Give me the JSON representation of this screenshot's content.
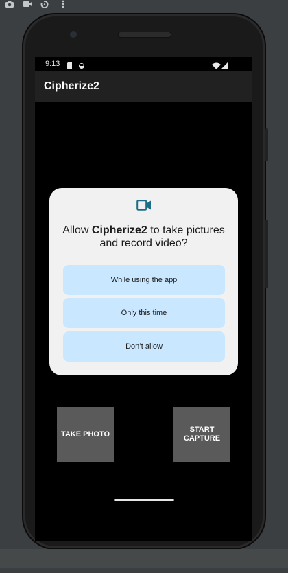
{
  "status_bar": {
    "time": "9:13"
  },
  "app_bar": {
    "title": "Cipherize2"
  },
  "dialog": {
    "message_prefix": "Allow ",
    "app_name": "Cipherize2",
    "message_suffix": " to take pictures and record video?",
    "options": [
      "While using the app",
      "Only this time",
      "Don’t allow"
    ],
    "accent_color": "#1a6e86",
    "option_bg": "#c9e7ff"
  },
  "buttons": {
    "take_photo": "TAKE PHOTO",
    "start_capture": "START\nCAPTURE"
  },
  "icons": {
    "toolbar": [
      "camera-icon",
      "video-icon",
      "rotate-icon",
      "more-vert-icon"
    ],
    "status": [
      "sd-card-icon",
      "sync-icon",
      "wifi-icon",
      "signal-icon"
    ],
    "dialog": "videocam-icon"
  }
}
